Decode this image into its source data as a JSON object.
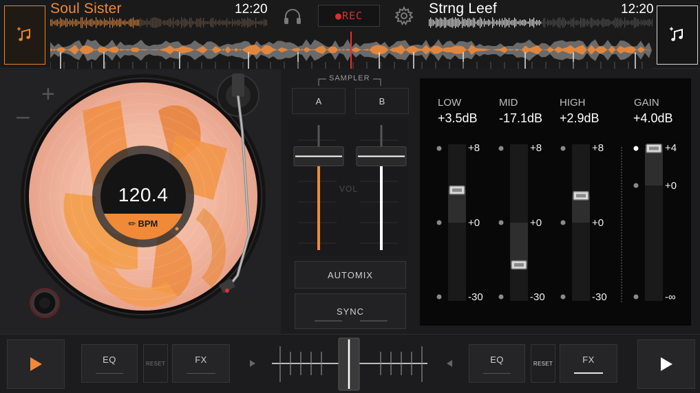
{
  "top": {
    "left_deck": {
      "title": "Soul Sister",
      "time": "12:20",
      "accent": "#f08a38"
    },
    "right_deck": {
      "title": "Strng Leef",
      "time": "12:20",
      "accent": "#ffffff"
    },
    "rec_label": "●REC",
    "icons": {
      "load_left": "music-add-icon",
      "load_right": "music-add-icon",
      "headphones": "headphones-icon",
      "settings": "gear-icon"
    }
  },
  "deck_left": {
    "bpm": "120.4",
    "bpm_label": "BPM",
    "pitch_plus": "+",
    "pitch_minus": "–"
  },
  "center": {
    "sampler_label": "SAMPLER",
    "pad_a": "A",
    "pad_b": "B",
    "vol_label": "VOL",
    "volume_left": 0.75,
    "volume_right": 0.75,
    "automix_label": "AUTOMIX",
    "sync_label": "SYNC"
  },
  "eq": {
    "bands": [
      {
        "name": "LOW",
        "value": "+3.5dB"
      },
      {
        "name": "MID",
        "value": "-17.1dB"
      },
      {
        "name": "HIGH",
        "value": "+2.9dB"
      },
      {
        "name": "GAIN",
        "value": "+4.0dB"
      }
    ],
    "scale_eq": {
      "top": "+8",
      "mid": "+0",
      "bottom": "-30"
    },
    "scale_gain": {
      "top": "+4",
      "mid": "+0",
      "bottom": "-∞"
    }
  },
  "bottom": {
    "eq_label_left": "EQ",
    "reset_label_left": "RESET",
    "fx_label_left": "FX",
    "eq_label_right": "EQ",
    "reset_label_right": "RESET",
    "fx_label_right": "FX",
    "crossfader_position": 0.5,
    "icons": {
      "play_left": "play-icon",
      "play_right": "play-icon",
      "xfader_left": "arrow-left-icon",
      "xfader_right": "arrow-right-icon"
    }
  }
}
